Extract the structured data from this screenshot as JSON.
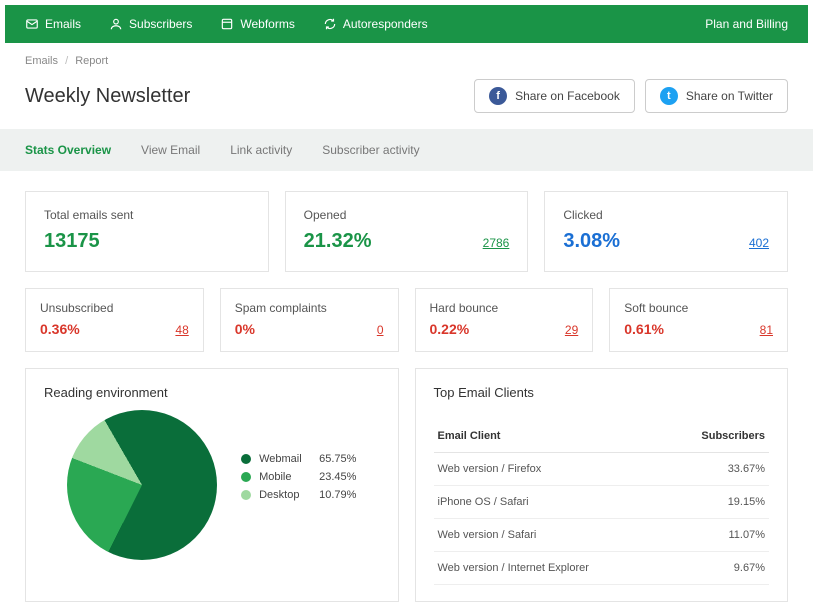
{
  "nav": {
    "items": [
      "Emails",
      "Subscribers",
      "Webforms",
      "Autoresponders"
    ],
    "right": "Plan and Billing"
  },
  "breadcrumb": {
    "root": "Emails",
    "current": "Report"
  },
  "page_title": "Weekly Newsletter",
  "share": {
    "facebook": "Share on Facebook",
    "twitter": "Share on Twitter"
  },
  "tabs": [
    "Stats Overview",
    "View Email",
    "Link activity",
    "Subscriber activity"
  ],
  "stats_primary": [
    {
      "label": "Total emails sent",
      "value": "13175",
      "count": "",
      "variant": "green"
    },
    {
      "label": "Opened",
      "value": "21.32%",
      "count": "2786",
      "variant": "green"
    },
    {
      "label": "Clicked",
      "value": "3.08%",
      "count": "402",
      "variant": "blue"
    }
  ],
  "stats_secondary": [
    {
      "label": "Unsubscribed",
      "value": "0.36%",
      "count": "48"
    },
    {
      "label": "Spam complaints",
      "value": "0%",
      "count": "0"
    },
    {
      "label": "Hard bounce",
      "value": "0.22%",
      "count": "29"
    },
    {
      "label": "Soft bounce",
      "value": "0.61%",
      "count": "81"
    }
  ],
  "reading_env": {
    "title": "Reading environment"
  },
  "clients": {
    "title": "Top Email Clients",
    "col1": "Email Client",
    "col2": "Subscribers",
    "rows": [
      {
        "name": "Web version / Firefox",
        "pct": "33.67%"
      },
      {
        "name": "iPhone OS / Safari",
        "pct": "19.15%"
      },
      {
        "name": "Web version / Safari",
        "pct": "11.07%"
      },
      {
        "name": "Web version / Internet Explorer",
        "pct": "9.67%"
      }
    ]
  },
  "chart_data": {
    "type": "pie",
    "title": "Reading environment",
    "series": [
      {
        "name": "Webmail",
        "value": 65.75,
        "color": "#0a6e3a"
      },
      {
        "name": "Mobile",
        "value": 23.45,
        "color": "#2aa853"
      },
      {
        "name": "Desktop",
        "value": 10.79,
        "color": "#9fd9a0"
      }
    ]
  }
}
